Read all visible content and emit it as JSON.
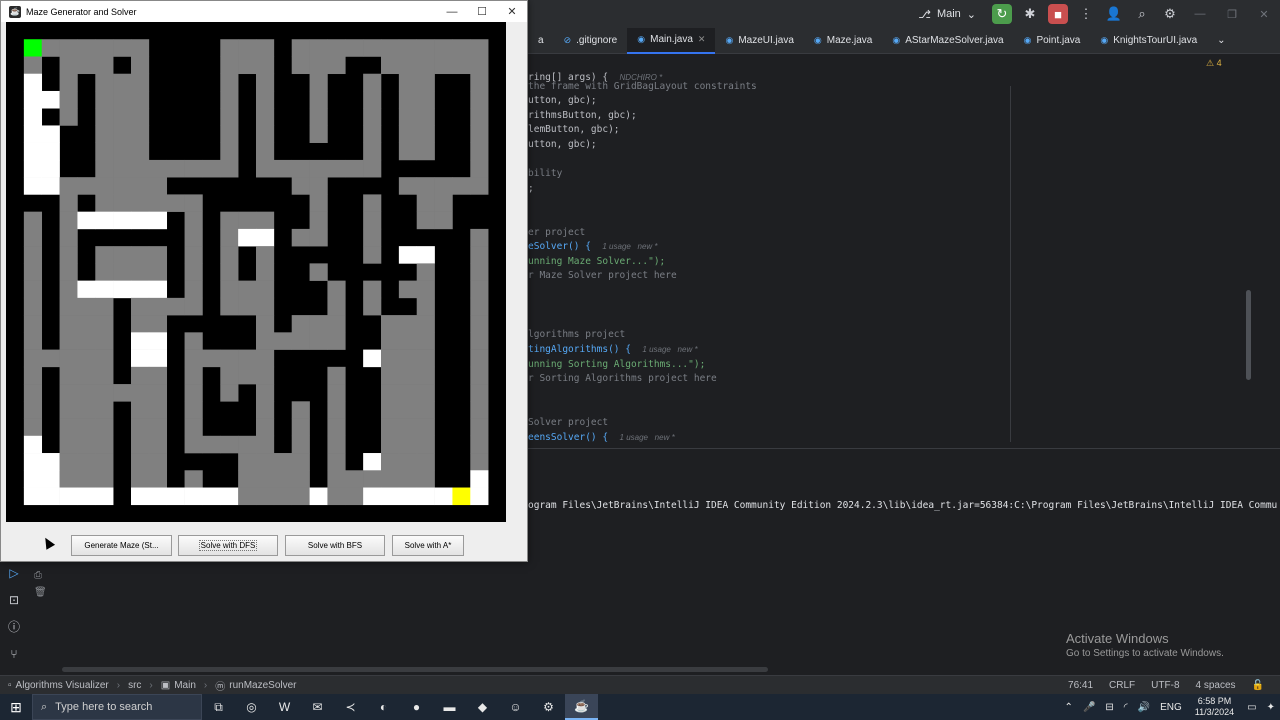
{
  "app_window": {
    "title": "Maze Generator and Solver",
    "buttons": [
      "Generate Maze (St...",
      "Solve with DFS",
      "Solve with BFS",
      "Solve with A*"
    ],
    "colors": {
      "wall": "#000000",
      "open": "#ffffff",
      "visited": "#808080",
      "start": "#00ff00",
      "end": "#ffff00"
    }
  },
  "maze": {
    "rows": 29,
    "cols": 29,
    "grid": [
      "1111111111111111111111111111",
      "1S22222213132221222222222221",
      "1212221213132221222112222221",
      "1012122213132121121121221121",
      "1002122213132121121121221121",
      "1012122213132121121121221121",
      "1001122211132121121121221121",
      "1001122211112121111121221121",
      "1001122222222122222221111121",
      "1002222221111111221111222221",
      "1112122222211111121121122111",
      "1212000001212221121121122111",
      "1212111111212001221121111121",
      "1212122221212121111121001121",
      "1212122221212121121111121121",
      "1212000001212221112121221121",
      "1212221222212221112121121121",
      "1212221221111121222112221121",
      "1212221001211122222112221121",
      "1222221001222221111102221121",
      "1212221221212221112112221121",
      "1212222221212121112112221121",
      "1212221221211121212112221121",
      "1212221221211121212112221121",
      "1012221221222221212112221121",
      "1002221221111222212102221121",
      "1002221221211222212222221101",
      "1000001000000222202200000E01",
      "1111111111111111111111111111"
    ]
  },
  "ide": {
    "branch": "Main",
    "tabs": [
      ".gitignore",
      "Main.java",
      "MazeUI.java",
      "Maze.java",
      "AStarMazeSolver.java",
      "Point.java",
      "KnightsTourUI.java"
    ],
    "active_tab": "Main.java",
    "tab_partial": "a",
    "warnings": "4",
    "code_lines": [
      "ring[] args) {",
      "the frame with GridBagLayout constraints",
      "utton, gbc);",
      "rithmsButton, gbc);",
      "lemButton, gbc);",
      "utton, gbc);",
      "bility",
      ";",
      "er project",
      "eSolver() {",
      "unning Maze Solver...\");",
      "r Maze Solver project here",
      "lgorithms project",
      "tingAlgorithms() {",
      "unning Sorting Algorithms...\");",
      "r Sorting Algorithms project here",
      "Solver project",
      "eensSolver() {"
    ],
    "hints": {
      "author": "NDCHIRO *",
      "usage_new_1": "1 usage   new *",
      "usage_new_2": "1 usage   new *",
      "usage_new_3": "1 usage   new *"
    },
    "run_command": "ogram Files\\JetBrains\\IntelliJ IDEA Community Edition 2024.2.3\\lib\\idea_rt.jar=56384:C:\\Program Files\\JetBrains\\IntelliJ IDEA Community",
    "activate_title": "Activate Windows",
    "activate_sub": "Go to Settings to activate Windows.",
    "breadcrumb": [
      "Algorithms Visualizer",
      "src",
      "Main",
      "runMazeSolver"
    ],
    "status": [
      "76:41",
      "CRLF",
      "UTF-8",
      "4 spaces"
    ]
  },
  "taskbar": {
    "search_placeholder": "Type here to search",
    "lang": "ENG",
    "time": "6:58 PM",
    "date": "11/3/2024"
  }
}
